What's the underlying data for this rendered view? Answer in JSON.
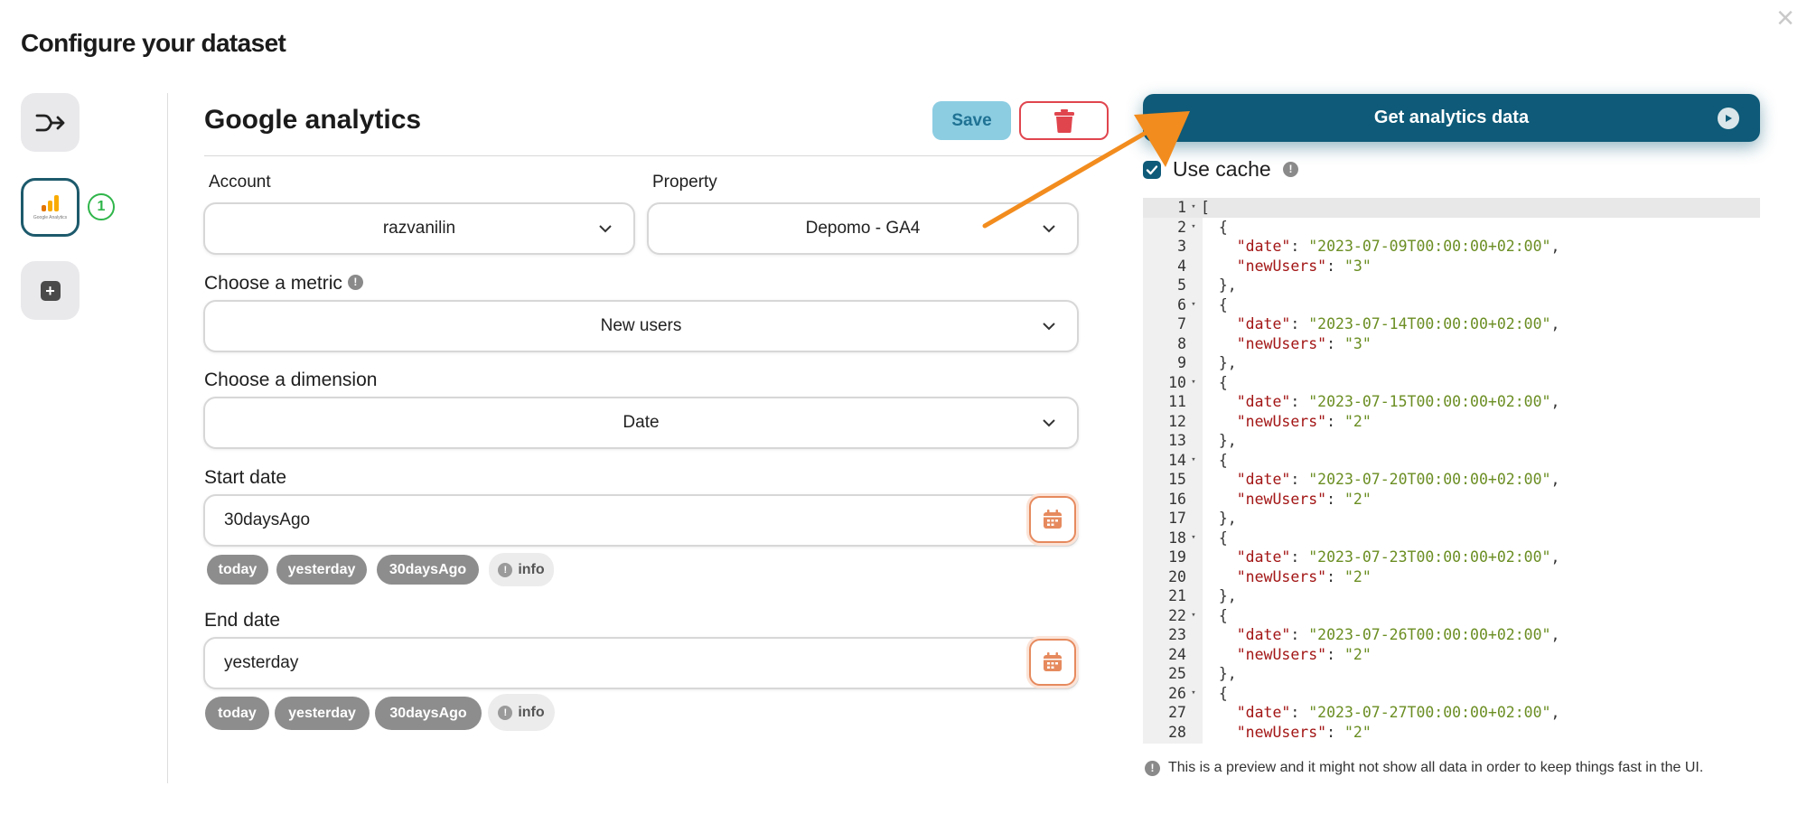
{
  "dialog": {
    "title": "Configure your dataset",
    "close_label": "×"
  },
  "sidebar": {
    "ga_logo_text": "Google Analytics",
    "source_count": "1",
    "add_label": "+"
  },
  "form": {
    "source_title": "Google analytics",
    "save_label": "Save",
    "account": {
      "label": "Account",
      "value": "razvanilin"
    },
    "property": {
      "label": "Property",
      "value": "Depomo - GA4"
    },
    "metric": {
      "label": "Choose a metric",
      "value": "New users"
    },
    "dimension": {
      "label": "Choose a dimension",
      "value": "Date"
    },
    "start_date": {
      "label": "Start date",
      "value": "30daysAgo",
      "chips": [
        "today",
        "yesterday",
        "30daysAgo",
        "info"
      ]
    },
    "end_date": {
      "label": "End date",
      "value": "yesterday",
      "chips": [
        "today",
        "yesterday",
        "30daysAgo",
        "info"
      ]
    }
  },
  "results": {
    "get_button_label": "Get analytics data",
    "use_cache_label": "Use cache",
    "use_cache_checked": true,
    "preview_note": "This is a preview and it might not show all data in order to keep things fast in the UI.",
    "code_lines": [
      "[",
      "  {",
      "    \"date\": \"2023-07-09T00:00:00+02:00\",",
      "    \"newUsers\": \"3\"",
      "  },",
      "  {",
      "    \"date\": \"2023-07-14T00:00:00+02:00\",",
      "    \"newUsers\": \"3\"",
      "  },",
      "  {",
      "    \"date\": \"2023-07-15T00:00:00+02:00\",",
      "    \"newUsers\": \"2\"",
      "  },",
      "  {",
      "    \"date\": \"2023-07-20T00:00:00+02:00\",",
      "    \"newUsers\": \"2\"",
      "  },",
      "  {",
      "    \"date\": \"2023-07-23T00:00:00+02:00\",",
      "    \"newUsers\": \"2\"",
      "  },",
      "  {",
      "    \"date\": \"2023-07-26T00:00:00+02:00\",",
      "    \"newUsers\": \"2\"",
      "  },",
      "  {",
      "    \"date\": \"2023-07-27T00:00:00+02:00\",",
      "    \"newUsers\": \"2\""
    ],
    "fold_lines": [
      1,
      2,
      6,
      10,
      14,
      18,
      22,
      26
    ]
  },
  "colors": {
    "primary": "#0e5a78",
    "save_bg": "#8ccde2",
    "delete": "#e0454e",
    "calendar": "#e68a5e",
    "annotation_arrow": "#f28c1e",
    "badge": "#2fb54a"
  },
  "icons": {
    "merge": "merge-arrow-icon",
    "delete": "trash-icon",
    "calendar": "calendar-icon",
    "chevron": "chevron-down-icon",
    "play": "play-icon",
    "info": "info-icon"
  }
}
